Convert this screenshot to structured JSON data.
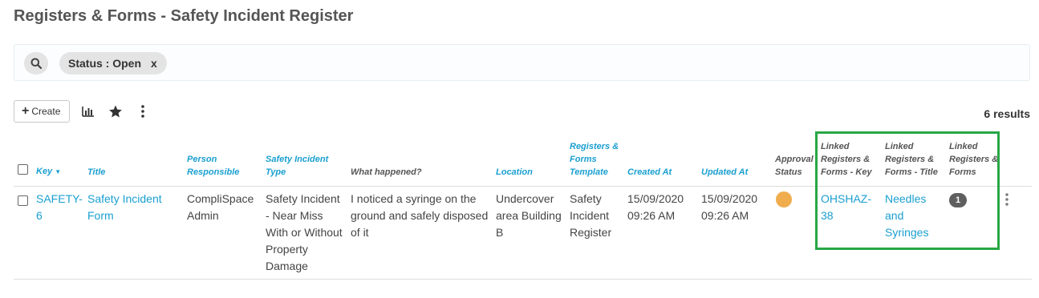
{
  "page": {
    "title": "Registers & Forms - Safety Incident Register"
  },
  "filter": {
    "chip_label": "Status : Open",
    "chip_remove": "x"
  },
  "toolbar": {
    "create_label": "Create"
  },
  "results": {
    "count_label": "6 results"
  },
  "columns": {
    "key": "Key",
    "title": "Title",
    "person": "Person Responsible",
    "type": "Safety Incident Type",
    "what": "What happened?",
    "location": "Location",
    "template": "Registers & Forms Template",
    "created": "Created At",
    "updated": "Updated At",
    "approval": "Approval Status",
    "linked_key": "Linked Registers & Forms - Key",
    "linked_title": "Linked Registers & Forms - Title",
    "linked_count": "Linked Registers & Forms"
  },
  "rows": [
    {
      "key": "SAFETY-6",
      "title": "Safety Incident Form",
      "person": "CompliSpace Admin",
      "type": "Safety Incident - Near Miss With or Without Property Damage",
      "what": "I noticed a syringe on the ground and safely disposed of it",
      "location": "Undercover area Building B",
      "template": "Safety Incident Register",
      "created": "15/09/2020 09:26 AM",
      "updated": "15/09/2020 09:26 AM",
      "approval_color": "#f0ad4e",
      "linked_key": "OHSHAZ-38",
      "linked_title": "Needles and Syringes",
      "linked_count": "1"
    }
  ],
  "colors": {
    "accent": "#1a9fd0",
    "highlight": "#28a745",
    "approval_pending": "#f0ad4e"
  }
}
